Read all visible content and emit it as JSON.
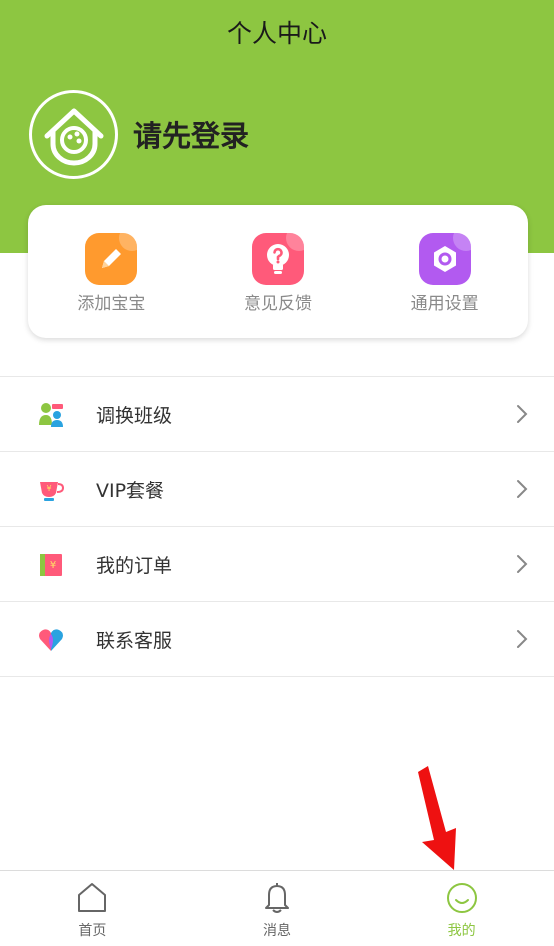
{
  "header": {
    "title": "个人中心",
    "login_prompt": "请先登录",
    "background_color": "#8dc641",
    "avatar_icon": "house-logo-icon"
  },
  "quick_actions": [
    {
      "label": "添加宝宝",
      "icon": "pencil-icon",
      "color": "#ff9a2e"
    },
    {
      "label": "意见反馈",
      "icon": "lightbulb-question-icon",
      "color": "#ff5a7a"
    },
    {
      "label": "通用设置",
      "icon": "hexagon-gear-icon",
      "color": "#b25af0"
    }
  ],
  "menu": [
    {
      "label": "调换班级",
      "icon": "class-switch-icon"
    },
    {
      "label": "VIP套餐",
      "icon": "vip-cup-icon"
    },
    {
      "label": "我的订单",
      "icon": "order-book-icon"
    },
    {
      "label": "联系客服",
      "icon": "heart-service-icon"
    }
  ],
  "tabs": [
    {
      "label": "首页",
      "icon": "home-icon",
      "active": false
    },
    {
      "label": "消息",
      "icon": "bell-icon",
      "active": false
    },
    {
      "label": "我的",
      "icon": "smile-icon",
      "active": true
    }
  ],
  "accent_color": "#8dc641",
  "annotation": {
    "icon": "red-arrow-icon",
    "color": "#ee1111"
  }
}
